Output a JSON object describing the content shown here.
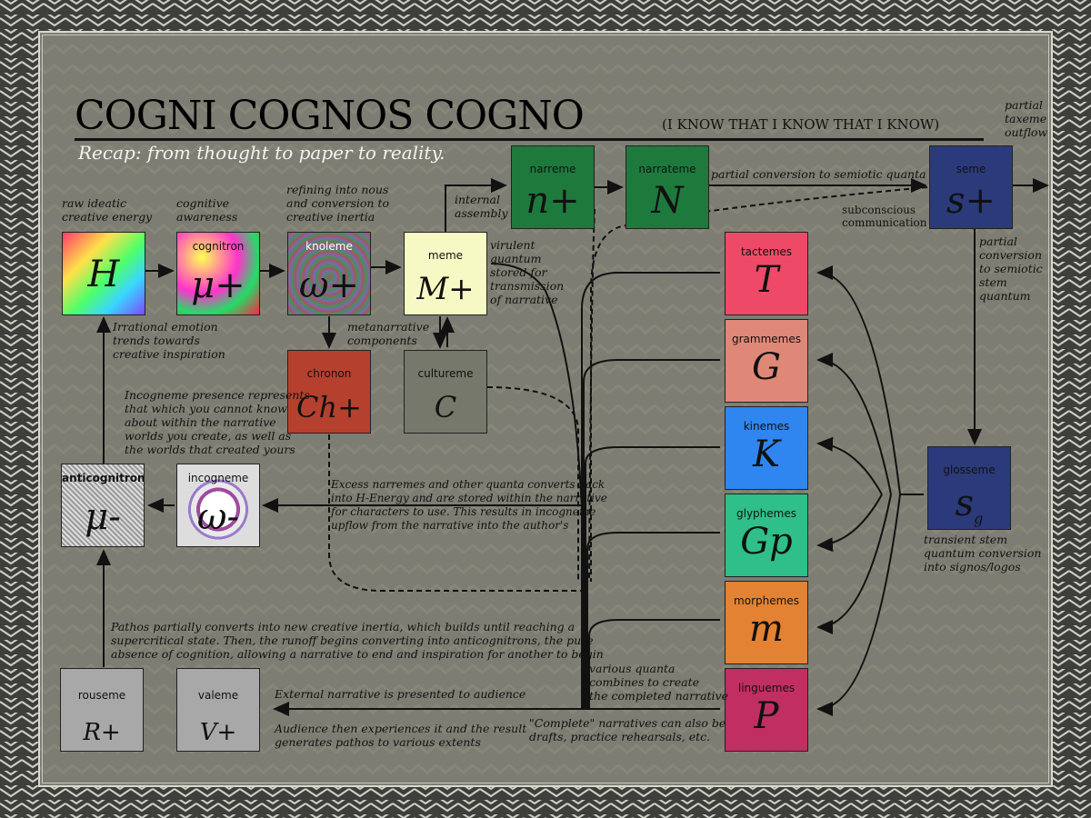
{
  "title": "COGNI COGNOS COGNO",
  "subtitle": "(I KNOW THAT I KNOW THAT I KNOW)",
  "recap": "Recap: from thought to paper to reality.",
  "nodes": {
    "h": {
      "label": "",
      "symbol": "H"
    },
    "cognitron": {
      "label": "cognitron",
      "symbol": "μ+"
    },
    "knoleme": {
      "label": "knoleme",
      "symbol": "ω+"
    },
    "meme": {
      "label": "meme",
      "symbol": "M+"
    },
    "chronon": {
      "label": "chronon",
      "symbol": "Ch+"
    },
    "cultureme": {
      "label": "cultureme",
      "symbol": "C"
    },
    "narreme": {
      "label": "narreme",
      "symbol": "n+"
    },
    "narrateme": {
      "label": "narrateme",
      "symbol": "N"
    },
    "seme": {
      "label": "seme",
      "symbol": "s+"
    },
    "tactemes": {
      "label": "tactemes",
      "symbol": "T"
    },
    "grammemes": {
      "label": "grammemes",
      "symbol": "G"
    },
    "kinemes": {
      "label": "kinemes",
      "symbol": "K"
    },
    "glyphemes": {
      "label": "glyphemes",
      "symbol": "Gp"
    },
    "morphemes": {
      "label": "morphemes",
      "symbol": "m"
    },
    "linguemes": {
      "label": "linguemes",
      "symbol": "P"
    },
    "glosseme": {
      "label": "glosseme",
      "symbol": "s",
      "sub": "g"
    },
    "anticognitron": {
      "label": "anticognitron",
      "symbol": "μ-"
    },
    "incogneme": {
      "label": "incogneme",
      "symbol": "ω-"
    },
    "rouseme": {
      "label": "rouseme",
      "symbol": "R+"
    },
    "valeme": {
      "label": "valeme",
      "symbol": "V+"
    }
  },
  "notes": {
    "raw": [
      "raw ideatic",
      "creative energy"
    ],
    "cognitive": [
      "cognitive",
      "awareness"
    ],
    "refining": [
      "refining into nous",
      "and conversion to",
      "creative inertia"
    ],
    "internal": [
      "internal",
      "assembly"
    ],
    "partial_conv": "partial conversion to semiotic quanta",
    "partial_taxeme": [
      "partial",
      "taxeme",
      "outflow"
    ],
    "subconscious": [
      "subconscious",
      "communication"
    ],
    "virulent": [
      "virulent",
      "quantum",
      "stored for",
      "transmission",
      "of narrative"
    ],
    "partial_stem": [
      "partial",
      "conversion",
      "to semiotic",
      "stem",
      "quantum"
    ],
    "irrational": [
      "Irrational emotion",
      "trends towards",
      "creative inspiration"
    ],
    "metanarrative": [
      "metanarrative",
      "components"
    ],
    "incogneme_presence": [
      "Incogneme presence represents",
      "that which you cannot know",
      "about within the narrative",
      "worlds you create, as well as",
      "the worlds that created yours"
    ],
    "excess": [
      "Excess narremes and other quanta converts back",
      "into H-Energy and are stored within the narrative",
      "for characters to use. This results in incogneme",
      "upflow from the narrative into the author's"
    ],
    "transient": [
      "transient stem",
      "quantum conversion",
      "into signos/logos"
    ],
    "pathos": [
      "Pathos partially converts into new creative inertia, which builds until reaching a",
      "supercritical state. Then, the runoff begins converting into anticognitrons, the pure",
      "absence of cognition, allowing a narrative to end and inspiration for another to begin"
    ],
    "various": [
      "various quanta",
      "combines to create",
      "the completed narrative"
    ],
    "external": "External narrative is presented to audience",
    "audience": [
      "Audience then experiences it and the result",
      "generates pathos to various extents"
    ],
    "complete": [
      "\"Complete\" narratives can also be",
      "drafts, practice rehearsals, etc."
    ]
  },
  "colors": {
    "background": "#7d7d73",
    "narreme": "#1d7a3c",
    "narrateme": "#1d7a3c",
    "seme": "#2b3a7a",
    "glosseme": "#2b3a7a",
    "meme": "#f7f9c4",
    "chronon": "#b5402e",
    "cultureme": "#75786a",
    "tactemes": "#ee4a68",
    "grammemes": "#e08878",
    "kinemes": "#2f86f0",
    "glyphemes": "#2fbf88",
    "morphemes": "#e28232",
    "linguemes": "#c02e62",
    "rouseme": "#a8a8a8",
    "valeme": "#a8a8a8"
  }
}
